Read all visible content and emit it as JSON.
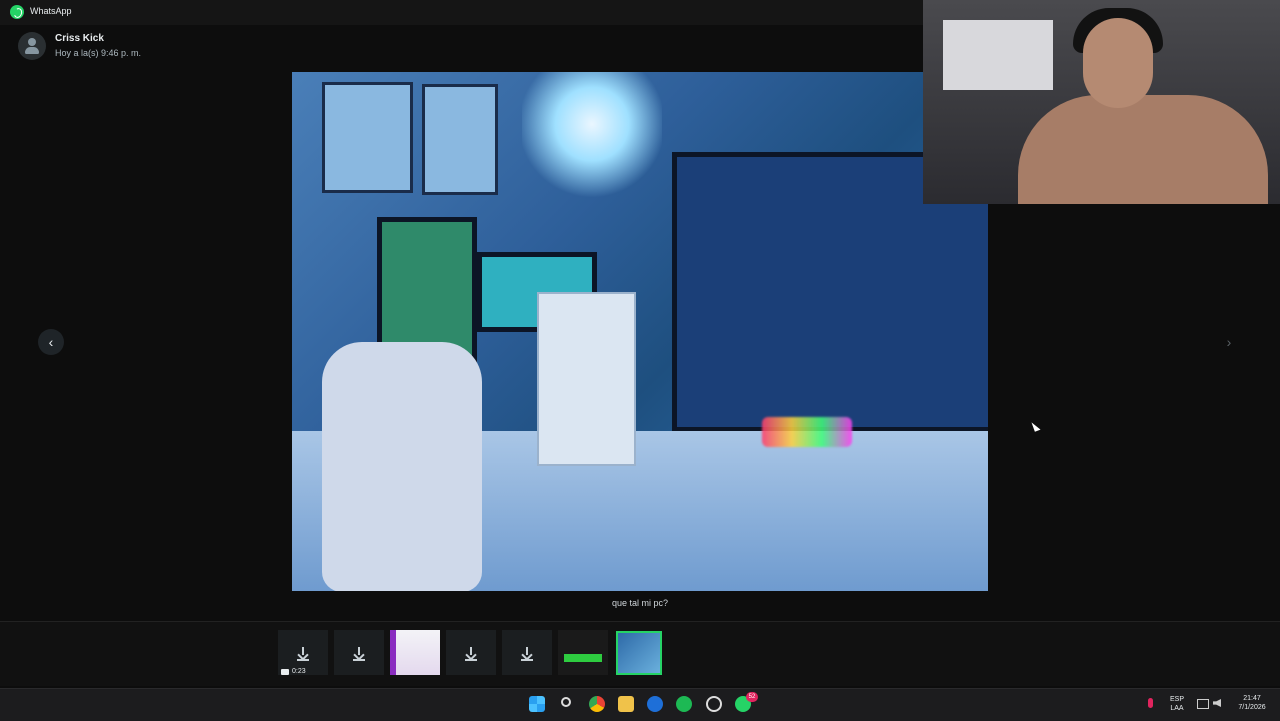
{
  "app": {
    "title": "WhatsApp"
  },
  "chat": {
    "contact_name": "Criss Kick",
    "timestamp": "Hoy a la(s) 9:46 p. m.",
    "caption": "que tal mi pc?"
  },
  "media_viewer": {
    "prev_glyph": "‹",
    "next_glyph": "›"
  },
  "thumbnails": [
    {
      "type": "download",
      "duration": "0:23"
    },
    {
      "type": "download"
    },
    {
      "type": "image"
    },
    {
      "type": "download"
    },
    {
      "type": "download"
    },
    {
      "type": "image"
    },
    {
      "type": "image",
      "active": true
    }
  ],
  "taskbar": {
    "whatsapp_badge": "52",
    "language_top": "ESP",
    "language_bottom": "LAA",
    "time": "21:47",
    "date": "7/1/2026"
  },
  "colors": {
    "accent": "#25d366",
    "background": "#0d0d0d"
  }
}
